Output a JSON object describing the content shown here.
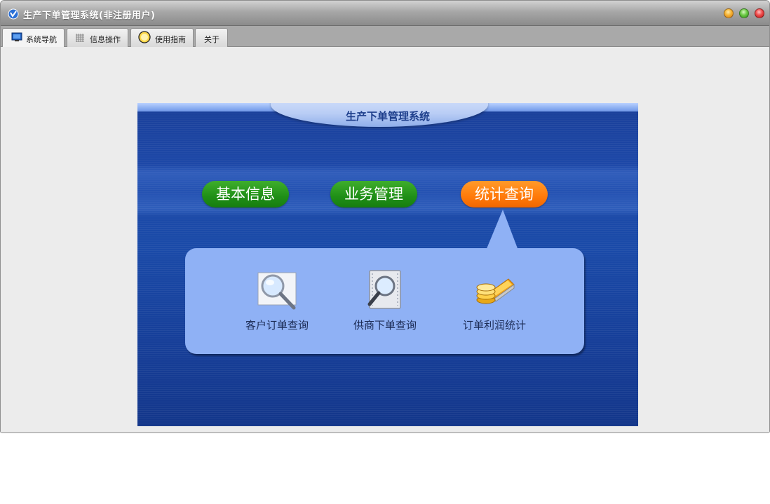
{
  "window": {
    "title": "生产下单管理系统(非注册用户)",
    "app_icon": "app-logo-icon",
    "controls": [
      "minimize-button",
      "maximize-button",
      "close-button"
    ]
  },
  "tabs": [
    {
      "label": "系统导航",
      "icon": "monitor-icon",
      "active": true
    },
    {
      "label": "信息操作",
      "icon": "grid-icon",
      "active": false
    },
    {
      "label": "使用指南",
      "icon": "help-circle-icon",
      "active": false
    },
    {
      "label": "关于",
      "icon": "",
      "active": false
    }
  ],
  "panel": {
    "title": "生产下单管理系统",
    "categories": [
      {
        "label": "基本信息",
        "color": "#2a9a1f",
        "selected": false
      },
      {
        "label": "业务管理",
        "color": "#2a9a1f",
        "selected": false
      },
      {
        "label": "统计查询",
        "color": "#ff7d10",
        "selected": true
      }
    ],
    "submenu": [
      {
        "label": "客户订单查询",
        "icon": "magnifier-icon"
      },
      {
        "label": "供商下单查询",
        "icon": "document-search-icon"
      },
      {
        "label": "订单利润统计",
        "icon": "coins-laptop-icon"
      }
    ]
  },
  "colors": {
    "accent_blue": "#1d48a8",
    "callout_blue": "#8fb1f5",
    "green": "#2a9a1f",
    "orange": "#ff7d10"
  }
}
